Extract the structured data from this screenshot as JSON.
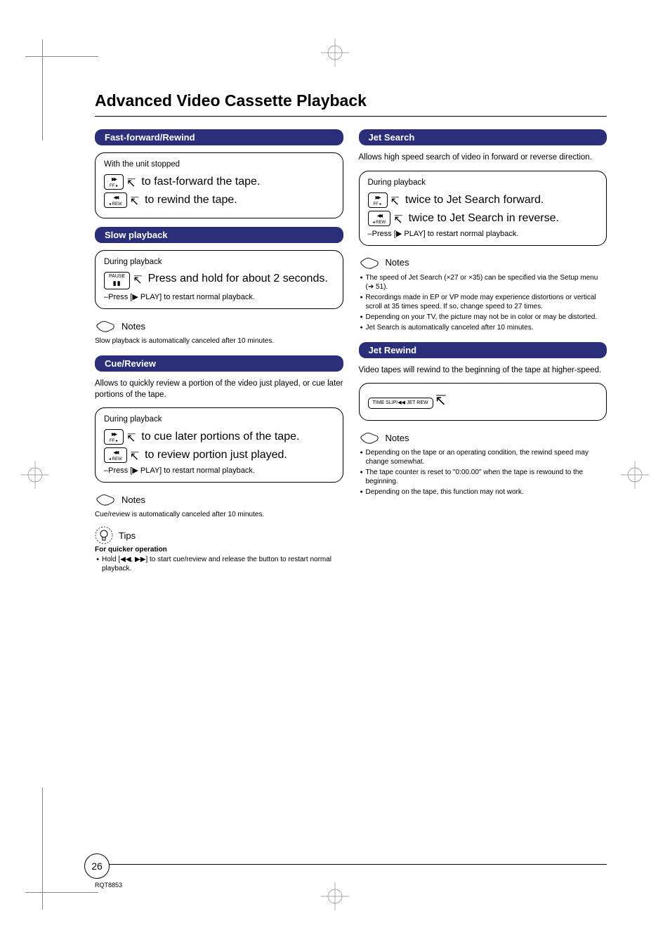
{
  "page": {
    "title": "Advanced Video Cassette Playback",
    "number": "26",
    "doc_id": "RQT8853"
  },
  "ffrw": {
    "header": "Fast-forward/Rewind",
    "context": "With the unit stopped",
    "ff_text": "to fast-forward the tape.",
    "rew_text": "to rewind the tape."
  },
  "slow": {
    "header": "Slow playback",
    "context": "During playback",
    "action": "Press and hold for about 2 seconds.",
    "restart": "–Press [▶ PLAY] to restart normal playback.",
    "notes_label": "Notes",
    "note1": "Slow playback is automatically canceled after 10 minutes."
  },
  "cue": {
    "header": "Cue/Review",
    "intro": "Allows to quickly review a portion of the video just played, or cue later portions of the tape.",
    "context": "During playback",
    "cue_text": "to cue later portions of the tape.",
    "review_text": "to review portion just played.",
    "restart": "–Press [▶ PLAY] to restart normal playback.",
    "notes_label": "Notes",
    "note1": "Cue/review is automatically canceled after 10 minutes.",
    "tips_label": "Tips",
    "tips_sub": "For quicker operation",
    "tips_bullet": "Hold [◀◀, ▶▶] to start cue/review and release the button to restart normal playback."
  },
  "jet": {
    "header": "Jet Search",
    "intro": "Allows high speed search of video in forward or reverse direction.",
    "context": "During playback",
    "fwd_text": "twice to Jet Search forward.",
    "rev_text": "twice to Jet Search in reverse.",
    "restart": "–Press [▶ PLAY] to restart normal playback.",
    "notes_label": "Notes",
    "note1": "The speed of Jet Search (×27 or ×35) can be specified via the Setup menu (➔ 51).",
    "note2": "Recordings made in EP or VP mode may experience distortions or vertical scroll at 35 times speed. If so, change speed to 27 times.",
    "note3": "Depending on your TV, the picture may not be in color or may be distorted.",
    "note4": "Jet Search is automatically canceled after 10 minutes."
  },
  "jetrew": {
    "header": "Jet Rewind",
    "intro": "Video tapes will rewind to the beginning of the tape at higher-speed.",
    "btn_label": "TIME SLIP/◀◀ JET REW",
    "notes_label": "Notes",
    "note1": "Depending on the tape or an operating condition, the rewind speed may change somewhat.",
    "note2": "The tape counter is reset to \"0:00.00\" when the tape is rewound to the beginning.",
    "note3": "Depending on the tape, this function may not work."
  },
  "btn_labels": {
    "ff_sub": "FF ▸",
    "rew_sub": "◂ REW",
    "pause": "PAUSE"
  }
}
